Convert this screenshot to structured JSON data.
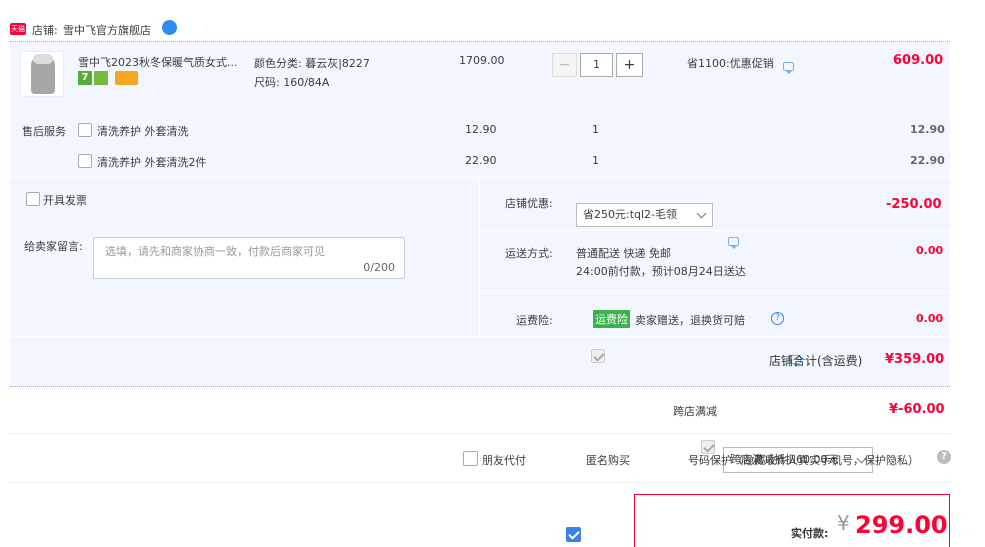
{
  "shop": {
    "badge": "天猫",
    "label": "店铺:",
    "name": "雪中飞官方旗舰店"
  },
  "item": {
    "title": "雪中飞2023秋冬保暖气质女式...",
    "attr_color": "颜色分类: 暮云灰|8227",
    "attr_size": "尺码: 160/84A",
    "unit_price": "1709.00",
    "quantity": "1",
    "discount": "省1100:优惠促销",
    "total": "609.00",
    "badge_7": "7"
  },
  "after_sales": {
    "label": "售后服务",
    "options": [
      {
        "name": "清洗养护 外套清洗",
        "price": "12.90",
        "qty": "1",
        "total": "12.90"
      },
      {
        "name": "清洗养护 外套清洗2件",
        "price": "22.90",
        "qty": "1",
        "total": "22.90"
      }
    ]
  },
  "invoice": {
    "label": "开具发票"
  },
  "message": {
    "label": "给卖家留言:",
    "placeholder": "选填，请先和商家协商一致，付款后商家可见",
    "counter": "0/200"
  },
  "shop_discount": {
    "label": "店铺优惠:",
    "selected": "省250元:tql2-毛领",
    "amount": "-250.00"
  },
  "shipping": {
    "label": "运送方式:",
    "method": "普通配送 快递 免邮",
    "note": "24:00前付款，预计08月24日送达",
    "amount": "0.00"
  },
  "insurance": {
    "label": "运费险:",
    "tag": "运费险",
    "text": "卖家赠送，退换货可赔",
    "amount": "0.00"
  },
  "shop_total": {
    "label": "店铺合计(含运费)",
    "amount": "¥359.00"
  },
  "cross_store": {
    "label": "跨店满减",
    "selected": "跨店满减抵扣60.00元",
    "amount": "¥-60.00"
  },
  "options": {
    "friend_pay": "朋友代付",
    "anonymous": "匿名购买",
    "privacy": "号码保护（隐藏收件人真实手机号，保护隐私）"
  },
  "payment": {
    "label": "实付款:",
    "currency": "¥",
    "amount": "299.00"
  },
  "colors": {
    "accent_red": "#ff0036",
    "light_blue_bg": "#f2f7ff",
    "checkbox_blue": "#3a82e6",
    "tag_green": "#3db14e"
  }
}
